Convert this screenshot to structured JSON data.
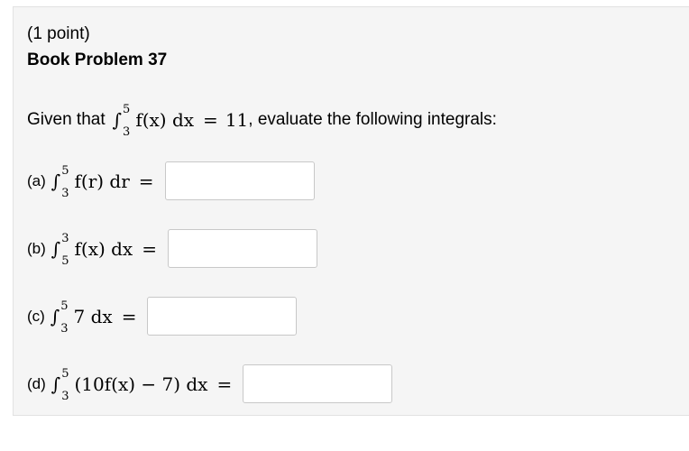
{
  "problem": {
    "points": "(1 point)",
    "title": "Book Problem 37"
  },
  "intro": {
    "prefix": "Given that",
    "integral": {
      "sign": "∫",
      "upper": "5",
      "lower": "3"
    },
    "integrand": "f(x) dx",
    "equals": "=",
    "value": "11",
    "suffix": ", evaluate the following integrals:"
  },
  "parts": [
    {
      "label": "(a)",
      "upper": "5",
      "lower": "3",
      "integrand": "f(r) dr",
      "equals": "=",
      "answer": ""
    },
    {
      "label": "(b)",
      "upper": "3",
      "lower": "5",
      "integrand": "f(x) dx",
      "equals": "=",
      "answer": ""
    },
    {
      "label": "(c)",
      "upper": "5",
      "lower": "3",
      "integrand": "7 dx",
      "equals": "=",
      "answer": ""
    },
    {
      "label": "(d)",
      "upper": "5",
      "lower": "3",
      "integrand": "(10f(x) − 7) dx",
      "equals": "=",
      "answer": ""
    }
  ]
}
